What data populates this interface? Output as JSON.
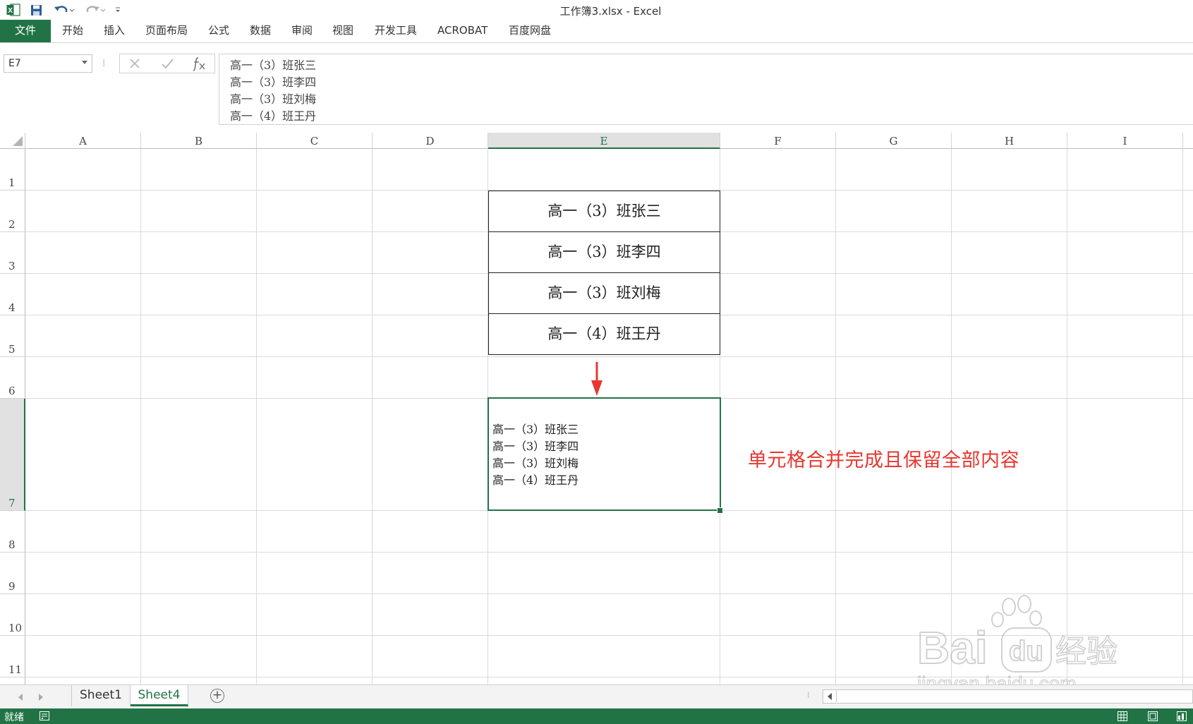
{
  "titlebar": {
    "title": "工作簿3.xlsx - Excel"
  },
  "ribbon": {
    "file": "文件",
    "tabs": [
      "开始",
      "插入",
      "页面布局",
      "公式",
      "数据",
      "审阅",
      "视图",
      "开发工具",
      "ACROBAT",
      "百度网盘"
    ]
  },
  "formula_bar": {
    "name_box": "E7",
    "separator": "⁝",
    "lines": [
      "高一（3）班张三",
      "高一（3）班李四",
      "高一（3）班刘梅",
      "高一（4）班王丹"
    ]
  },
  "columns": [
    "A",
    "B",
    "C",
    "D",
    "E",
    "F",
    "G",
    "H",
    "I"
  ],
  "rows": [
    "1",
    "2",
    "3",
    "4",
    "5",
    "6",
    "7",
    "8",
    "9",
    "10",
    "11"
  ],
  "cells": {
    "e2": "高一（3）班张三",
    "e3": "高一（3）班李四",
    "e4": "高一（3）班刘梅",
    "e5": "高一（4）班王丹",
    "e7_lines": [
      "高一（3）班张三",
      "高一（3）班李四",
      "高一（3）班刘梅",
      "高一（4）班王丹"
    ]
  },
  "annotation": {
    "note": "单元格合并完成且保留全部内容",
    "color": "#e8362f"
  },
  "sheets": {
    "tabs": [
      "Sheet1",
      "Sheet4"
    ],
    "active": "Sheet4",
    "add": "+"
  },
  "status": {
    "text": "就绪"
  },
  "watermark": {
    "brand": "Bai",
    "du": "du",
    "cn": "经验",
    "url": "jingyan.baidu.com"
  },
  "colors": {
    "accent": "#217346",
    "grid": "#dadada"
  }
}
